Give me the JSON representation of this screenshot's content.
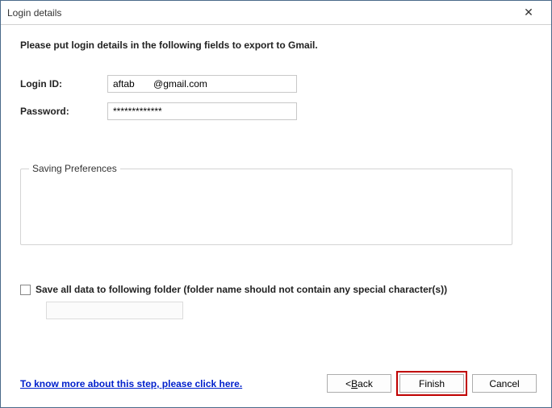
{
  "window": {
    "title": "Login details",
    "close_icon": "✕"
  },
  "instruction": "Please put login details in the following fields to export to Gmail.",
  "form": {
    "login_label": "Login ID:",
    "login_value": "aftab       @gmail.com",
    "password_label": "Password:",
    "password_value": "*************"
  },
  "fieldset": {
    "legend": "Saving Preferences"
  },
  "checkbox": {
    "label": "Save all data to following folder (folder name should not contain any special character(s))"
  },
  "help_link": "To know more about this step, please click here.",
  "buttons": {
    "back_prefix": "< ",
    "back_key": "B",
    "back_rest": "ack",
    "finish": "Finish",
    "cancel": "Cancel"
  }
}
